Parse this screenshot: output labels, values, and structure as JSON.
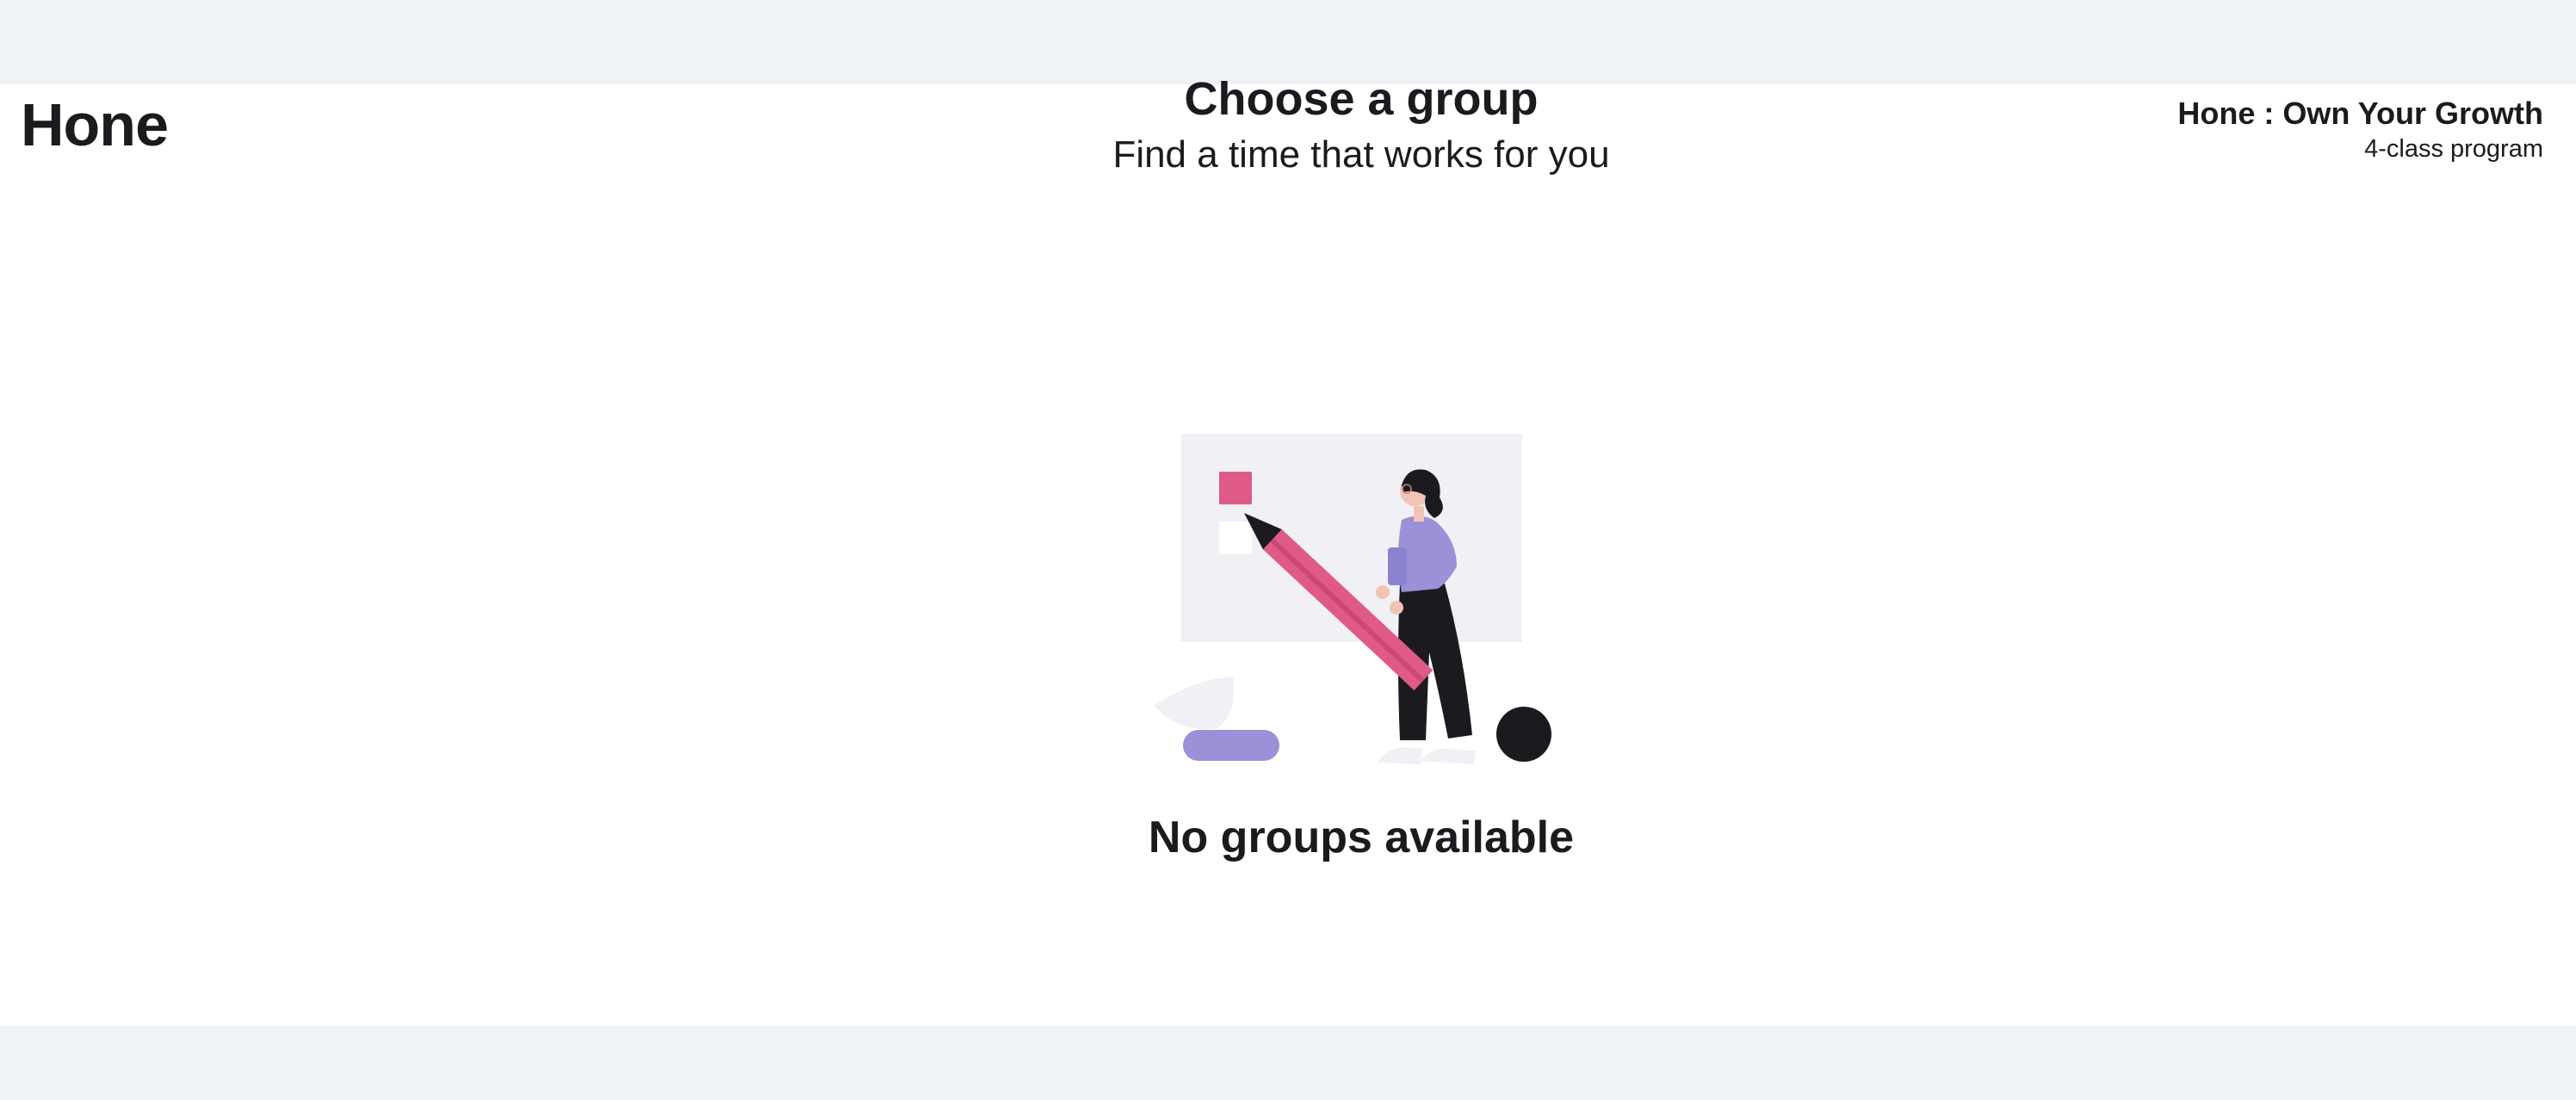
{
  "brand": {
    "logo_text": "Hone"
  },
  "header": {
    "title": "Choose a group",
    "subtitle": "Find a time that works for you"
  },
  "program": {
    "name": "Hone : Own Your Growth",
    "description": "4-class program"
  },
  "empty_state": {
    "illustration": "person-with-pencil-illustration",
    "message": "No groups available"
  },
  "colors": {
    "page_background": "#eff2f6",
    "panel_background": "#ffffff",
    "text": "#1b1b1f",
    "pencil_pink": "#e05a87",
    "shirt_purple": "#9a91d8"
  }
}
